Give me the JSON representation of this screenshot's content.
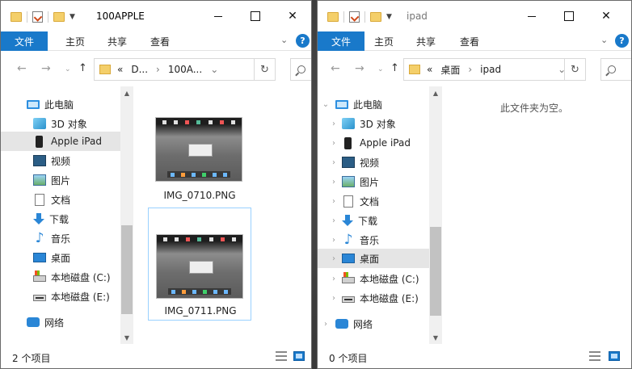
{
  "left_window": {
    "title": "100APPLE",
    "ribbon": {
      "file": "文件",
      "home": "主页",
      "share": "共享",
      "view": "查看"
    },
    "address": {
      "prefix": "«",
      "segments": [
        "D...",
        "100A..."
      ]
    },
    "nav_tree": [
      {
        "label": "此电脑",
        "icon": "pc-icon"
      },
      {
        "label": "3D 对象",
        "icon": "3d-objects-icon"
      },
      {
        "label": "Apple iPad",
        "icon": "ipad-icon"
      },
      {
        "label": "视频",
        "icon": "video-icon"
      },
      {
        "label": "图片",
        "icon": "pictures-icon"
      },
      {
        "label": "文档",
        "icon": "documents-icon"
      },
      {
        "label": "下载",
        "icon": "download-icon"
      },
      {
        "label": "音乐",
        "icon": "music-icon"
      },
      {
        "label": "桌面",
        "icon": "desktop-icon"
      },
      {
        "label": "本地磁盘 (C:)",
        "icon": "drive-c-icon"
      },
      {
        "label": "本地磁盘 (E:)",
        "icon": "drive-e-icon"
      },
      {
        "label": "网络",
        "icon": "network-icon"
      }
    ],
    "files": [
      {
        "name": "IMG_0710.PNG"
      },
      {
        "name": "IMG_0711.PNG"
      }
    ],
    "status": "2 个项目"
  },
  "right_window": {
    "title": "ipad",
    "ribbon": {
      "file": "文件",
      "home": "主页",
      "share": "共享",
      "view": "查看"
    },
    "address": {
      "prefix": "«",
      "segments": [
        "桌面",
        "ipad"
      ]
    },
    "nav_tree": [
      {
        "label": "此电脑",
        "icon": "pc-icon"
      },
      {
        "label": "3D 对象",
        "icon": "3d-objects-icon"
      },
      {
        "label": "Apple iPad",
        "icon": "ipad-icon"
      },
      {
        "label": "视频",
        "icon": "video-icon"
      },
      {
        "label": "图片",
        "icon": "pictures-icon"
      },
      {
        "label": "文档",
        "icon": "documents-icon"
      },
      {
        "label": "下载",
        "icon": "download-icon"
      },
      {
        "label": "音乐",
        "icon": "music-icon"
      },
      {
        "label": "桌面",
        "icon": "desktop-icon"
      },
      {
        "label": "本地磁盘 (C:)",
        "icon": "drive-c-icon"
      },
      {
        "label": "本地磁盘 (E:)",
        "icon": "drive-e-icon"
      },
      {
        "label": "网络",
        "icon": "network-icon"
      }
    ],
    "empty_message": "此文件夹为空。",
    "status": "0 个项目"
  },
  "colors": {
    "accent": "#1979ca",
    "selection": "#cce4f7",
    "hover": "#e5e5e5"
  }
}
